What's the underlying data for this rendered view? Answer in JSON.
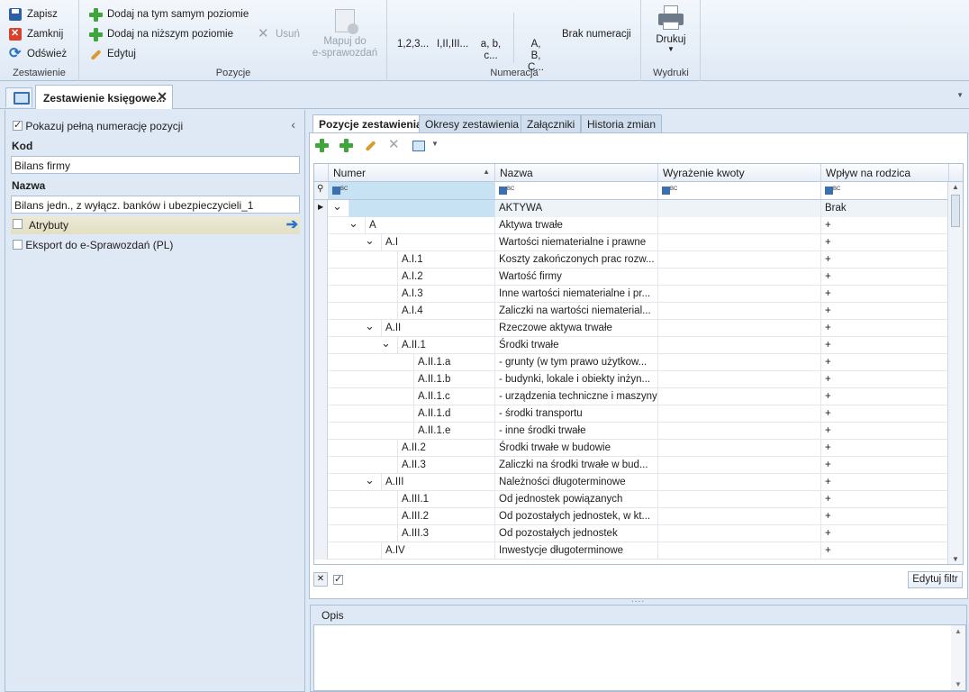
{
  "ribbon": {
    "groups": {
      "zestawienie": "Zestawienie",
      "pozycje": "Pozycje",
      "numeracja": "Numeracja",
      "wydruki": "Wydruki"
    },
    "zapisz": "Zapisz",
    "zamknij": "Zamknij",
    "odswiez": "Odśwież",
    "dodaj_tym": "Dodaj na tym samym poziomie",
    "dodaj_nizszym": "Dodaj na niższym poziomie",
    "edytuj": "Edytuj",
    "usun": "Usuń",
    "mapuj_1": "Mapuj do",
    "mapuj_2": "e-sprawozdań",
    "num_123": "1,2,3...",
    "num_roman": "I,II,III...",
    "num_abc_1": "a, b,",
    "num_abc_2": "c...",
    "num_ABC_1": "A, B,",
    "num_ABC_2": "C...",
    "brak_numeracji": "Brak numeracji",
    "drukuj": "Drukuj"
  },
  "doc_tab": {
    "title": "Zestawienie księgowe..."
  },
  "left": {
    "pelna_numeracja": "Pokazuj pełną numerację pozycji",
    "kod_label": "Kod",
    "kod_value": "Bilans firmy",
    "nazwa_label": "Nazwa",
    "nazwa_value": "Bilans jedn., z wyłącz. banków i ubezpieczycieli_1",
    "atrybuty": "Atrybuty",
    "eksport": "Eksport do e-Sprawozdań (PL)"
  },
  "tabs": [
    "Pozycje zestawienia",
    "Okresy zestawienia",
    "Załączniki",
    "Historia zmian"
  ],
  "grid": {
    "columns": [
      "Numer",
      "Nazwa",
      "Wyrażenie kwoty",
      "Wpływ na rodzica"
    ],
    "rows": [
      {
        "num": "",
        "name": "AKTYWA",
        "effect": "Brak"
      },
      {
        "num": "A",
        "name": "Aktywa trwałe",
        "effect": "+"
      },
      {
        "num": "A.I",
        "name": "Wartości niematerialne i prawne",
        "effect": "+"
      },
      {
        "num": "A.I.1",
        "name": "Koszty zakończonych prac rozw...",
        "effect": "+"
      },
      {
        "num": "A.I.2",
        "name": "Wartość firmy",
        "effect": "+"
      },
      {
        "num": "A.I.3",
        "name": "Inne wartości niematerialne i pr...",
        "effect": "+"
      },
      {
        "num": "A.I.4",
        "name": "Zaliczki na wartości niematerial...",
        "effect": "+"
      },
      {
        "num": "A.II",
        "name": "Rzeczowe aktywa trwałe",
        "effect": "+"
      },
      {
        "num": "A.II.1",
        "name": "Środki trwałe",
        "effect": "+"
      },
      {
        "num": "A.II.1.a",
        "name": "- grunty (w tym prawo użytkow...",
        "effect": "+"
      },
      {
        "num": "A.II.1.b",
        "name": "- budynki, lokale i obiekty inżyn...",
        "effect": "+"
      },
      {
        "num": "A.II.1.c",
        "name": "- urządzenia techniczne i maszyny",
        "effect": "+"
      },
      {
        "num": "A.II.1.d",
        "name": "- środki transportu",
        "effect": "+"
      },
      {
        "num": "A.II.1.e",
        "name": "- inne środki trwałe",
        "effect": "+"
      },
      {
        "num": "A.II.2",
        "name": "Środki trwałe w budowie",
        "effect": "+"
      },
      {
        "num": "A.II.3",
        "name": "Zaliczki na środki trwałe w bud...",
        "effect": "+"
      },
      {
        "num": "A.III",
        "name": "Należności długoterminowe",
        "effect": "+"
      },
      {
        "num": "A.III.1",
        "name": "Od jednostek powiązanych",
        "effect": "+"
      },
      {
        "num": "A.III.2",
        "name": "Od pozostałych jednostek, w kt...",
        "effect": "+"
      },
      {
        "num": "A.III.3",
        "name": "Od pozostałych jednostek",
        "effect": "+"
      },
      {
        "num": "A.IV",
        "name": "Inwestycje długoterminowe",
        "effect": "+"
      }
    ],
    "edytuj_filtr": "Edytuj filtr"
  },
  "opis": {
    "label": "Opis"
  }
}
